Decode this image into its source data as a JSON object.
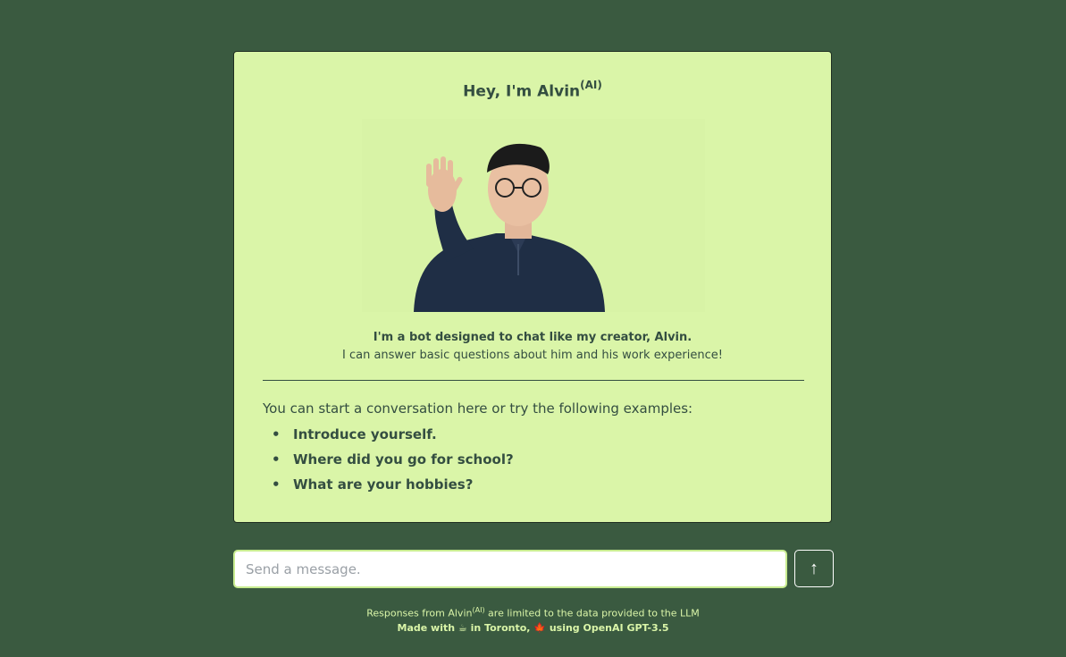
{
  "header": {
    "title": "Hey, I'm Alvin",
    "title_sup": "(AI)"
  },
  "intro": {
    "bold": "I'm a bot designed to chat like my creator, Alvin.",
    "text": "I can answer basic questions about him and his work experience!"
  },
  "examples": {
    "intro": "You can start a conversation here or try the following examples:",
    "items": [
      {
        "label": "Introduce yourself."
      },
      {
        "label": "Where did you go for school?"
      },
      {
        "label": "What are your hobbies?"
      }
    ]
  },
  "input": {
    "placeholder": "Send a message."
  },
  "send_button": {
    "icon": "arrow-up-icon",
    "glyph": "↑"
  },
  "footer": {
    "line1_pre": "Responses from Alvin",
    "line1_sup": "(AI)",
    "line1_post": " are limited to the data provided to the LLM",
    "line2_a": "Made with ",
    "coffee_glyph": "☕",
    "line2_b": " in Toronto, ",
    "leaf_glyph": "🍁",
    "line2_c": " using OpenAI GPT-3.5"
  },
  "colors": {
    "background": "#3a5a40",
    "card": "#daf5a8",
    "text": "#344e41",
    "input_border": "#c8ec90"
  }
}
